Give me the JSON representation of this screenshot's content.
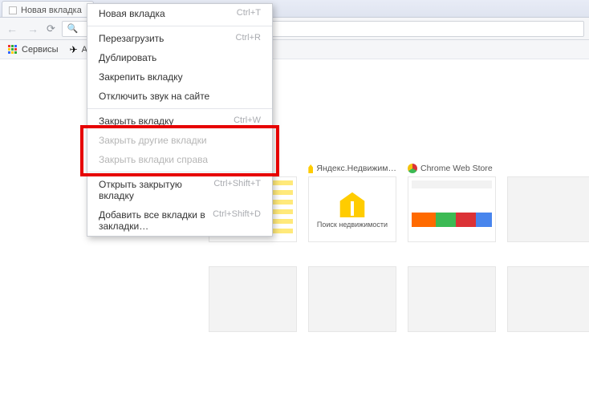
{
  "tab": {
    "title": "Новая вкладка"
  },
  "bookmarks": {
    "apps": "Сервисы",
    "avia": "Ави"
  },
  "thumbs": {
    "realty_title": "Яндекс.Недвижим…",
    "realty_caption": "Поиск недвижимости",
    "cws_title": "Chrome Web Store"
  },
  "menu": {
    "new_tab": {
      "label": "Новая вкладка",
      "shortcut": "Ctrl+T"
    },
    "reload": {
      "label": "Перезагрузить",
      "shortcut": "Ctrl+R"
    },
    "duplicate": {
      "label": "Дублировать",
      "shortcut": ""
    },
    "pin": {
      "label": "Закрепить вкладку",
      "shortcut": ""
    },
    "mute": {
      "label": "Отключить звук на сайте",
      "shortcut": ""
    },
    "close": {
      "label": "Закрыть вкладку",
      "shortcut": "Ctrl+W"
    },
    "close_others": {
      "label": "Закрыть другие вкладки",
      "shortcut": ""
    },
    "close_right": {
      "label": "Закрыть вкладки справа",
      "shortcut": ""
    },
    "reopen": {
      "label": "Открыть закрытую вкладку",
      "shortcut": "Ctrl+Shift+T"
    },
    "bookmark_all": {
      "label": "Добавить все вкладки в закладки…",
      "shortcut": "Ctrl+Shift+D"
    }
  }
}
